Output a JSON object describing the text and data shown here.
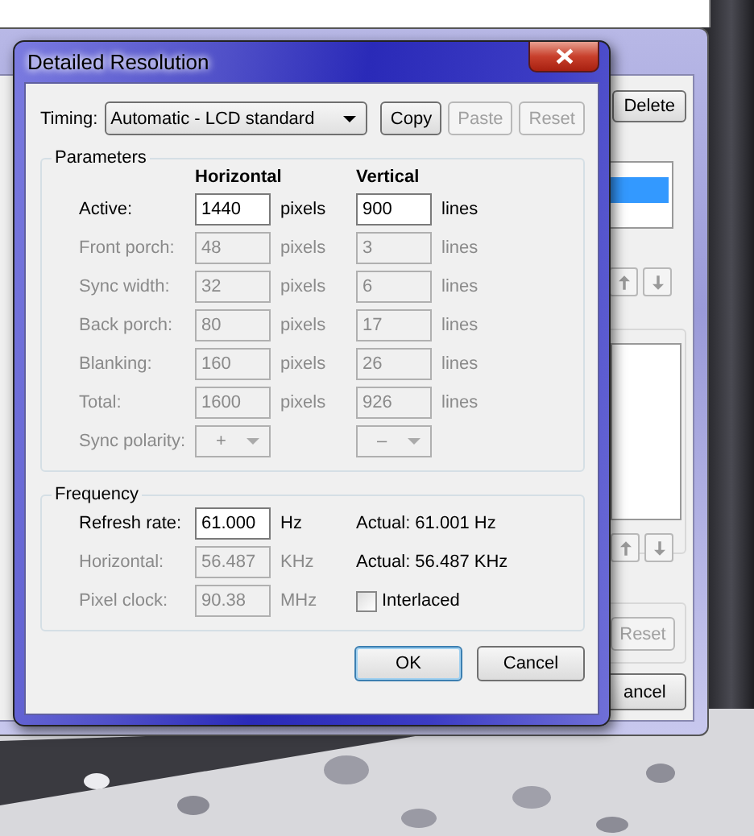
{
  "back_window": {
    "buttons": [
      {
        "label": "Delete",
        "disabled": false
      },
      {
        "label": "Reset",
        "disabled": true
      },
      {
        "label": "ancel",
        "disabled": false
      }
    ]
  },
  "dialog": {
    "title": "Detailed Resolution",
    "timing": {
      "label": "Timing:",
      "value": "Automatic - LCD standard"
    },
    "timing_buttons": [
      {
        "label": "Copy",
        "disabled": false
      },
      {
        "label": "Paste",
        "disabled": true
      },
      {
        "label": "Reset",
        "disabled": true
      }
    ],
    "parameters": {
      "title": "Parameters",
      "columns": [
        "Horizontal",
        "Vertical"
      ],
      "rows": [
        {
          "kind": "field",
          "label": "Active:",
          "disabled": false,
          "h_value": "1440",
          "h_unit": "pixels",
          "v_value": "900",
          "v_unit": "lines"
        },
        {
          "kind": "field",
          "label": "Front porch:",
          "disabled": true,
          "h_value": "48",
          "h_unit": "pixels",
          "v_value": "3",
          "v_unit": "lines"
        },
        {
          "kind": "field",
          "label": "Sync width:",
          "disabled": true,
          "h_value": "32",
          "h_unit": "pixels",
          "v_value": "6",
          "v_unit": "lines"
        },
        {
          "kind": "field",
          "label": "Back porch:",
          "disabled": true,
          "h_value": "80",
          "h_unit": "pixels",
          "v_value": "17",
          "v_unit": "lines"
        },
        {
          "kind": "field",
          "label": "Blanking:",
          "disabled": true,
          "h_value": "160",
          "h_unit": "pixels",
          "v_value": "26",
          "v_unit": "lines"
        },
        {
          "kind": "field",
          "label": "Total:",
          "disabled": true,
          "h_value": "1600",
          "h_unit": "pixels",
          "v_value": "926",
          "v_unit": "lines"
        },
        {
          "kind": "dropdown",
          "label": "Sync polarity:",
          "disabled": true,
          "h_value": "+",
          "v_value": "–"
        }
      ]
    },
    "frequency": {
      "title": "Frequency",
      "rows": [
        {
          "kind": "text",
          "label": "Refresh rate:",
          "disabled": false,
          "value": "61.000",
          "unit": "Hz",
          "extra": "Actual: 61.001 Hz"
        },
        {
          "kind": "text",
          "label": "Horizontal:",
          "disabled": true,
          "value": "56.487",
          "unit": "KHz",
          "extra": "Actual: 56.487 KHz"
        },
        {
          "kind": "checkbox",
          "label": "Pixel clock:",
          "disabled": true,
          "value": "90.38",
          "unit": "MHz",
          "extra": "Interlaced",
          "checked": false
        }
      ]
    },
    "buttons": [
      {
        "label": "OK",
        "default": true
      },
      {
        "label": "Cancel",
        "default": false
      }
    ]
  }
}
